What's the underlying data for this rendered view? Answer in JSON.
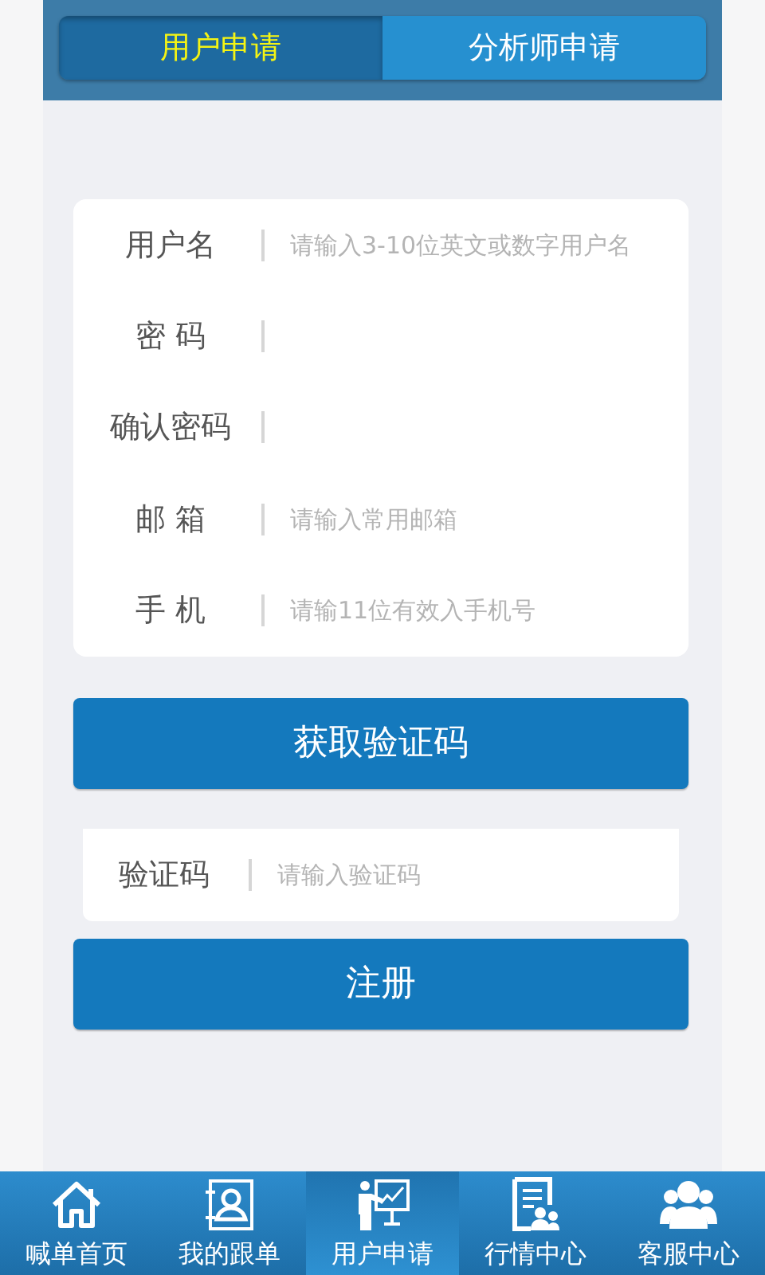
{
  "tabs": [
    {
      "label": "用户申请",
      "selected": true
    },
    {
      "label": "分析师申请",
      "selected": false
    }
  ],
  "form": {
    "fields": [
      {
        "label": "用户名",
        "placeholder": "请输入3-10位英文或数字用户名"
      },
      {
        "label": "密 码"
      },
      {
        "label": "确认密码"
      },
      {
        "label": "邮 箱",
        "placeholder": "请输入常用邮箱"
      },
      {
        "label": "手 机",
        "placeholder": "请输11位有效入手机号"
      }
    ]
  },
  "code_button": "获取验证码",
  "code_field": {
    "label": "验证码",
    "placeholder": "请输入验证码"
  },
  "register_button": "注册",
  "bottom_nav": [
    {
      "label": "喊单首页",
      "selected": false
    },
    {
      "label": "我的跟单",
      "selected": false
    },
    {
      "label": "用户申请",
      "selected": true
    },
    {
      "label": "行情中心",
      "selected": false
    },
    {
      "label": "客服中心",
      "selected": false
    }
  ]
}
